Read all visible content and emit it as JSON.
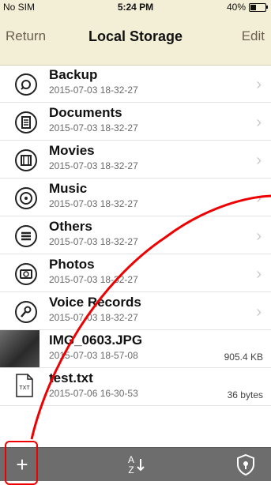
{
  "status": {
    "carrier": "No SIM",
    "time": "5:24 PM",
    "battery": "40%"
  },
  "nav": {
    "back": "Return",
    "title": "Local Storage",
    "edit": "Edit"
  },
  "items": [
    {
      "name": "Backup",
      "date": "2015-07-03 18-32-27",
      "icon": "backup-icon"
    },
    {
      "name": "Documents",
      "date": "2015-07-03 18-32-27",
      "icon": "documents-icon"
    },
    {
      "name": "Movies",
      "date": "2015-07-03 18-32-27",
      "icon": "movies-icon"
    },
    {
      "name": "Music",
      "date": "2015-07-03 18-32-27",
      "icon": "music-icon"
    },
    {
      "name": "Others",
      "date": "2015-07-03 18-32-27",
      "icon": "others-icon"
    },
    {
      "name": "Photos",
      "date": "2015-07-03 18-32-27",
      "icon": "photos-icon"
    },
    {
      "name": "Voice Records",
      "date": "2015-07-03 18-32-27",
      "icon": "microphone-icon"
    }
  ],
  "files": [
    {
      "name": "IMG_0603.JPG",
      "date": "2015-07-03 18-57-08",
      "size": "905.4 KB"
    },
    {
      "name": "test.txt",
      "date": "2015-07-06 16-30-53",
      "size": "36 bytes",
      "badge": "TXT"
    }
  ],
  "toolbar": {
    "plus": "+",
    "sort_top": "A",
    "sort_bottom": "Z"
  },
  "colors": {
    "bar": "#f3eed6",
    "accent": "#6d5f4e",
    "toolbar": "#6d6d6d",
    "highlight": "#e00000"
  }
}
